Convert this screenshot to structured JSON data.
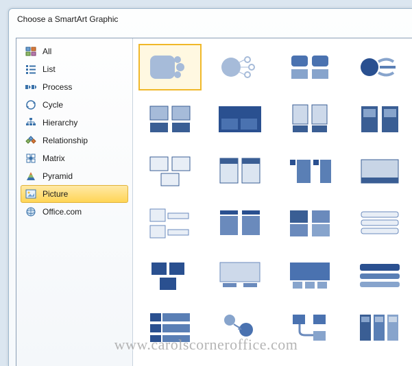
{
  "window": {
    "title": "Choose a SmartArt Graphic"
  },
  "sidebar": {
    "items": [
      {
        "label": "All",
        "icon": "all"
      },
      {
        "label": "List",
        "icon": "list"
      },
      {
        "label": "Process",
        "icon": "process"
      },
      {
        "label": "Cycle",
        "icon": "cycle"
      },
      {
        "label": "Hierarchy",
        "icon": "hierarchy"
      },
      {
        "label": "Relationship",
        "icon": "relationship"
      },
      {
        "label": "Matrix",
        "icon": "matrix"
      },
      {
        "label": "Pyramid",
        "icon": "pyramid"
      },
      {
        "label": "Picture",
        "icon": "picture"
      },
      {
        "label": "Office.com",
        "icon": "office"
      }
    ],
    "selected_index": 8
  },
  "gallery": {
    "selected_index": 0,
    "count": 24
  },
  "watermark": "www.carolscorneroffice.com"
}
